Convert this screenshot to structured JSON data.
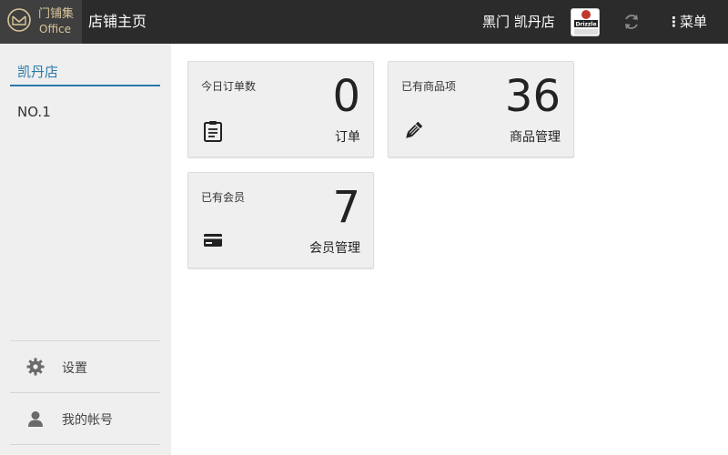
{
  "header": {
    "logo_text": "门铺集",
    "logo_sub": "Office",
    "page_title": "店铺主页",
    "store_name": "黑门 凯丹店",
    "avatar_text": "Drizzle",
    "menu_label": "菜单",
    "icons": {
      "logo": "logo-mark-icon",
      "refresh": "refresh-icon",
      "menu": "vertical-dots-icon"
    }
  },
  "sidebar": {
    "active_store": "凯丹店",
    "items": [
      {
        "label": "NO.1"
      }
    ],
    "actions": [
      {
        "label": "设置",
        "icon": "gear-icon"
      },
      {
        "label": "我的帐号",
        "icon": "user-icon"
      }
    ],
    "accent_color": "#2b7aa8"
  },
  "cards": [
    {
      "title": "今日订单数",
      "value": "0",
      "label": "订单",
      "icon": "clipboard-icon"
    },
    {
      "title": "已有商品项",
      "value": "36",
      "label": "商品管理",
      "icon": "pencil-icon"
    },
    {
      "title": "已有会员",
      "value": "7",
      "label": "会员管理",
      "icon": "credit-card-icon"
    }
  ]
}
